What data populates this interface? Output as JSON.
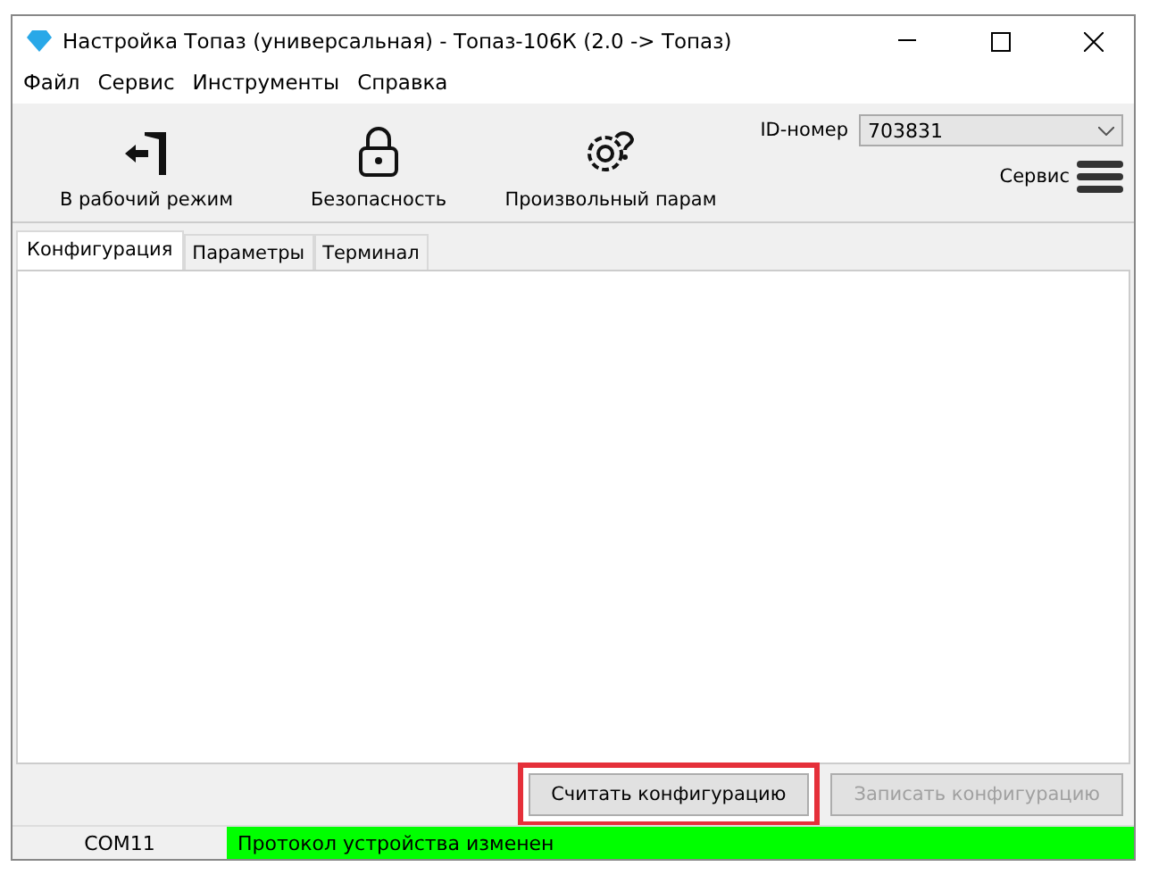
{
  "window": {
    "title": "Настройка Топаз (универсальная) - Топаз-106К (2.0 -> Топаз)"
  },
  "menu": [
    "Файл",
    "Сервис",
    "Инструменты",
    "Справка"
  ],
  "toolbar": {
    "actions": [
      {
        "kind": "exit",
        "label": "В рабочий режим"
      },
      {
        "kind": "lock",
        "label": "Безопасность"
      },
      {
        "kind": "gear",
        "label": "Произвольный парам"
      }
    ],
    "id_field": {
      "label": "ID-номер",
      "value": "703831"
    },
    "service": {
      "label": "Сервис"
    }
  },
  "tabs": [
    {
      "label": "Конфигурация",
      "selected": true
    },
    {
      "label": "Параметры",
      "selected": false
    },
    {
      "label": "Терминал",
      "selected": false
    }
  ],
  "buttons": [
    {
      "label": "Считать конфигурацию",
      "disabled": false,
      "highlighted": true
    },
    {
      "label": "Записать конфигурацию",
      "disabled": true,
      "highlighted": false
    }
  ],
  "status_bar": {
    "port": "COM11",
    "message": "Протокол устройства изменен",
    "color": "#00ff00"
  }
}
